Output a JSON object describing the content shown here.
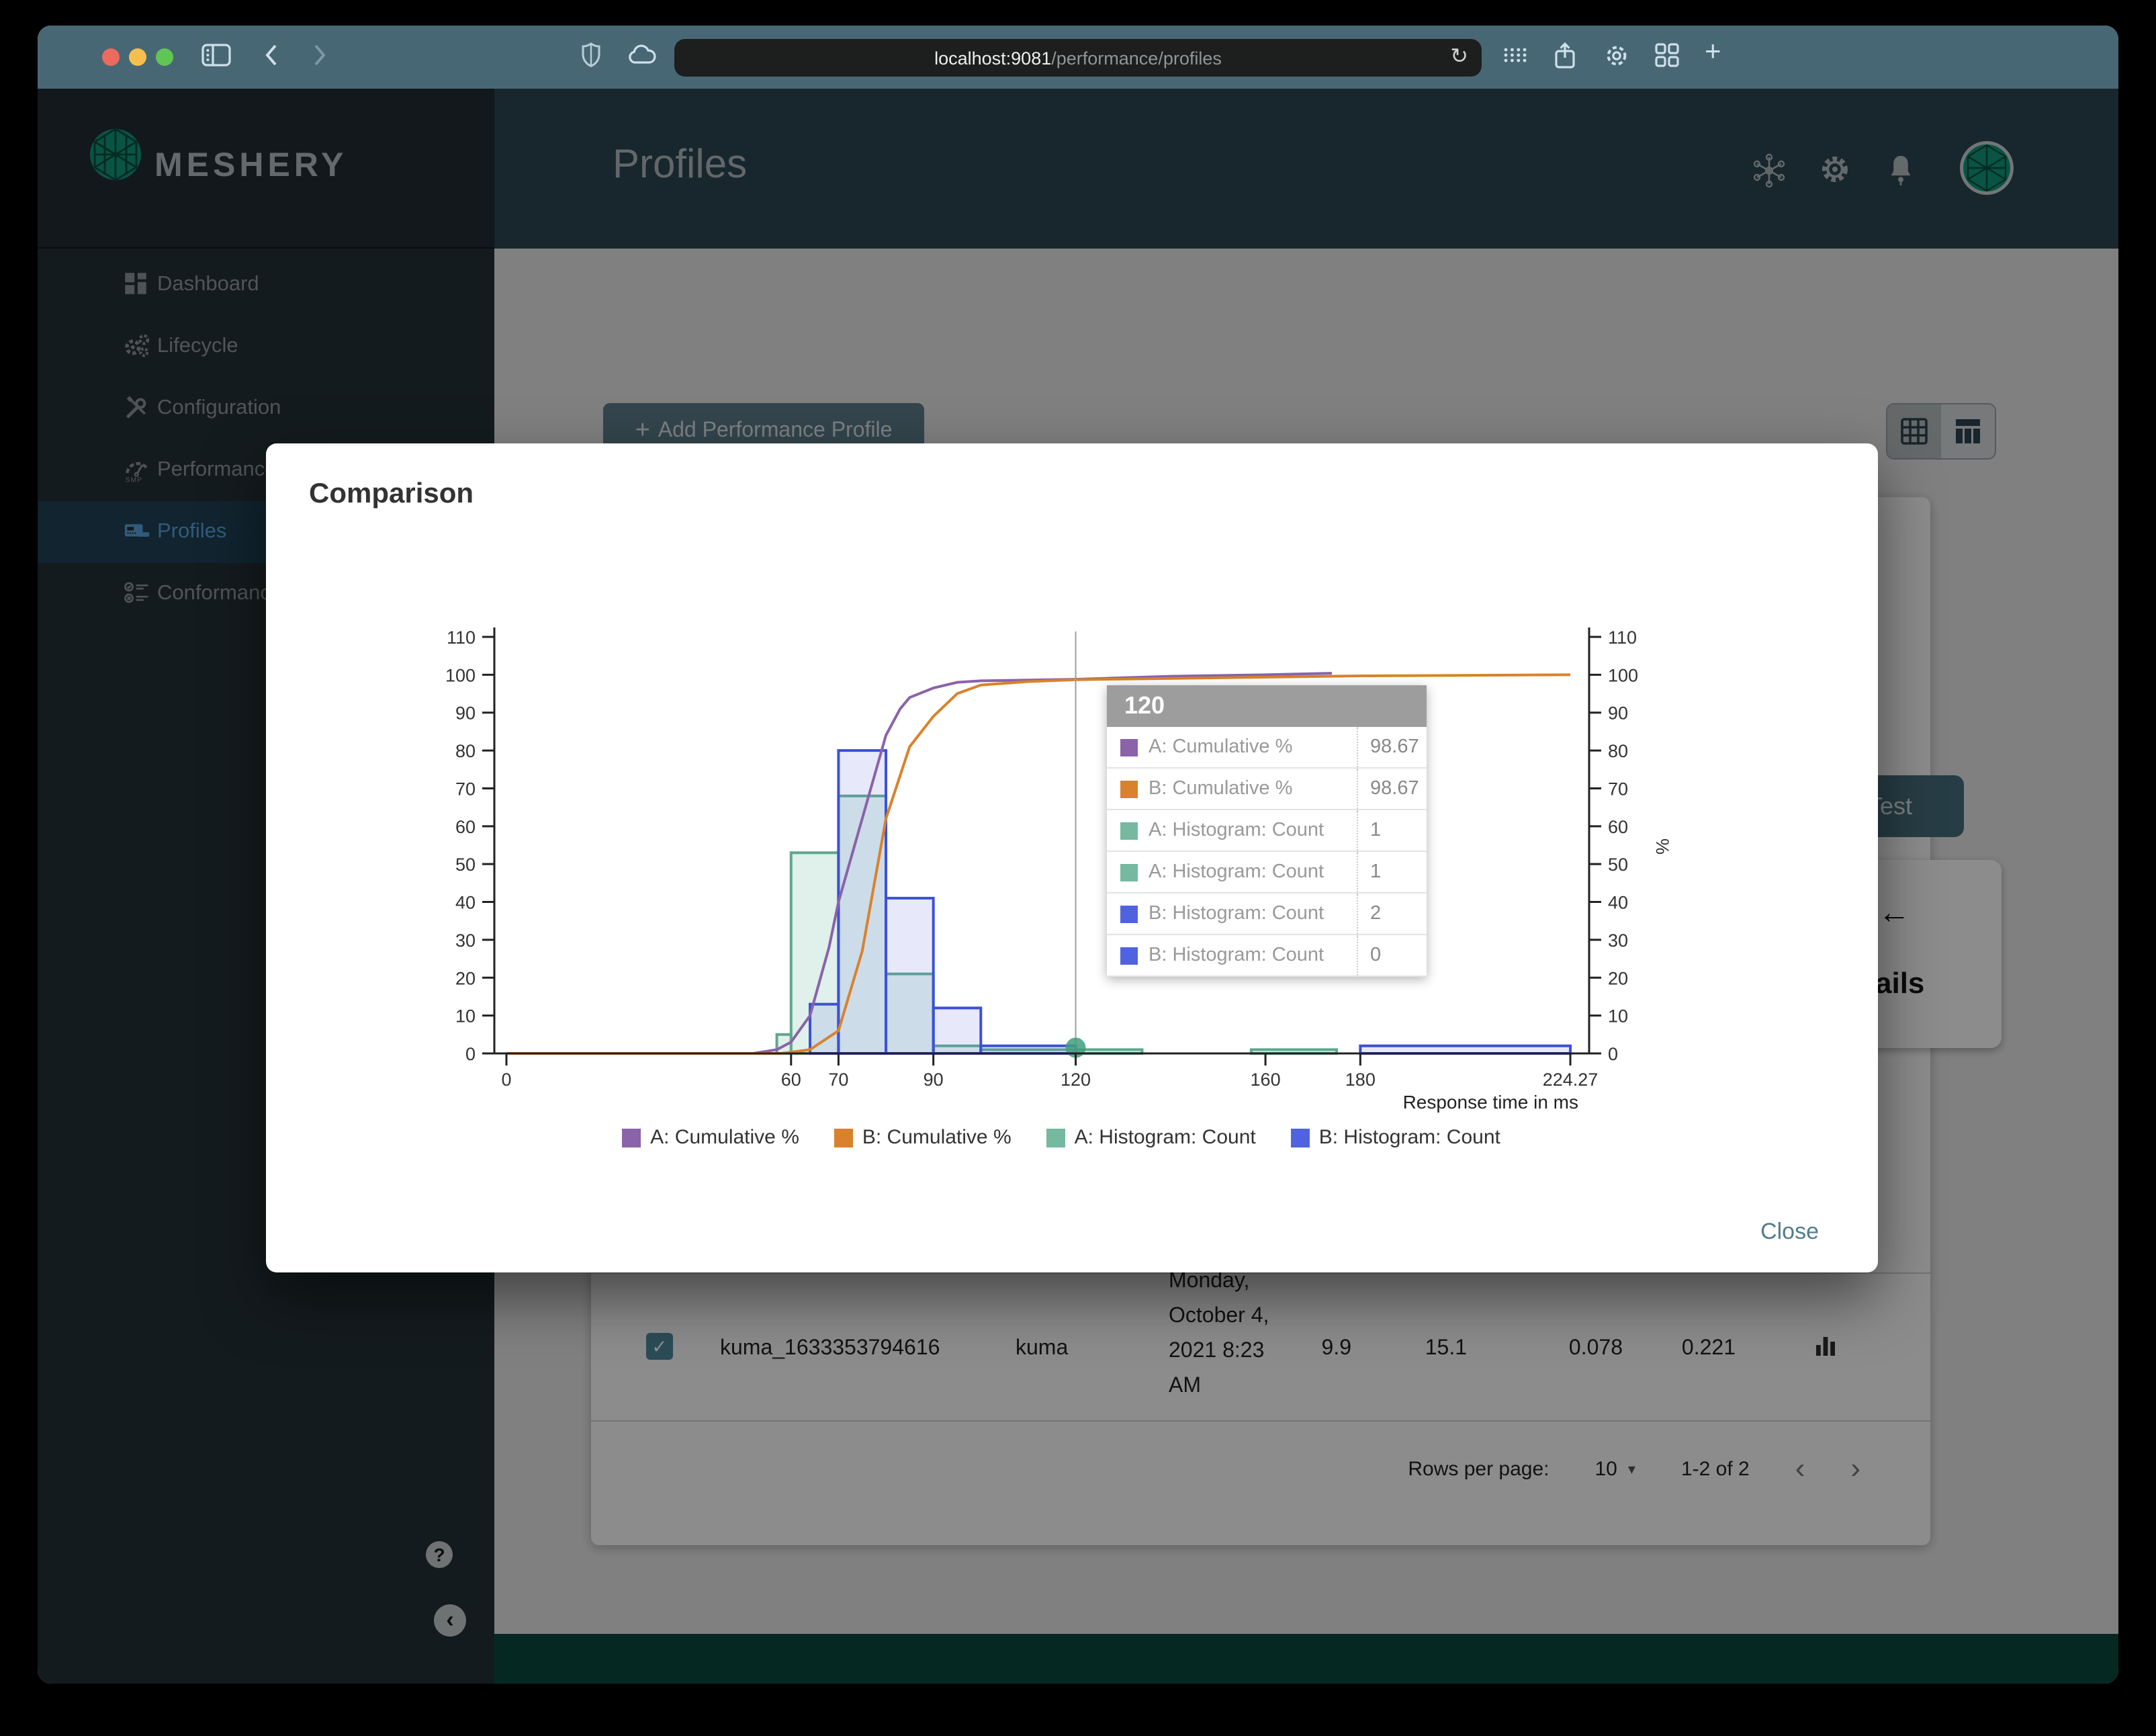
{
  "browser": {
    "url_host": "localhost:9081",
    "url_path": "/performance/profiles",
    "reload_glyph": "↻",
    "plus_glyph": "+"
  },
  "sidebar": {
    "brand": "MESHERY",
    "items": [
      {
        "label": "Dashboard",
        "icon": "dashboard-icon",
        "active": false
      },
      {
        "label": "Lifecycle",
        "icon": "lifecycle-icon",
        "active": false
      },
      {
        "label": "Configuration",
        "icon": "configuration-icon",
        "active": false
      },
      {
        "label": "Performance",
        "icon": "performance-icon",
        "active": false
      },
      {
        "label": "Profiles",
        "icon": "profiles-icon",
        "active": true
      },
      {
        "label": "Conformance",
        "icon": "conformance-icon",
        "active": false
      }
    ],
    "smp_label": "SMP",
    "help_glyph": "?",
    "collapse_glyph": "‹"
  },
  "header": {
    "title": "Profiles"
  },
  "content": {
    "add_profile_button": "Add Performance Profile",
    "test_button": "Test",
    "back_arrow": "←",
    "details_fragment": "ails",
    "row": {
      "checkbox_glyph": "✓",
      "name": "kuma_1633353794616",
      "mesh": "kuma",
      "date": "Monday, October 4, 2021 8:23 AM",
      "qps": "9.9",
      "duration": "15.1",
      "p50": "0.078",
      "p99": "0.221"
    },
    "pagination": {
      "label": "Rows per page:",
      "value": "10",
      "caret": "▾",
      "range": "1-2 of 2",
      "prev": "‹",
      "next": "›"
    }
  },
  "modal": {
    "title": "Comparison",
    "close_button": "Close"
  },
  "chart_data": {
    "type": "histogram+cumulative-line",
    "title": "",
    "xlabel": "Response time in ms",
    "right_axis_label": "%",
    "xlim": [
      0,
      224.27
    ],
    "ylim": [
      0,
      110
    ],
    "x_ticks": [
      0,
      60,
      70,
      90,
      120,
      160,
      180,
      224.27
    ],
    "y_ticks": [
      0,
      10,
      20,
      30,
      40,
      50,
      60,
      70,
      80,
      90,
      100,
      110
    ],
    "grid": false,
    "legend_position": "bottom",
    "hover": {
      "x": 120,
      "dot_y": 1.5,
      "dot_color": "#3f9e7d",
      "line_color": "#9e9e9e"
    },
    "series": [
      {
        "name": "A: Histogram: Count",
        "type": "histogram",
        "fill": "rgba(116,185,160,0.22)",
        "stroke": "#5fa78e",
        "bins": [
          [
            57,
            60,
            5
          ],
          [
            60,
            70,
            53
          ],
          [
            70,
            80,
            68
          ],
          [
            80,
            90,
            21
          ],
          [
            90,
            100,
            2
          ],
          [
            100,
            134,
            1
          ],
          [
            157,
            175,
            1
          ]
        ]
      },
      {
        "name": "B: Histogram: Count",
        "type": "histogram",
        "fill": "rgba(91,110,226,0.15)",
        "stroke": "#3c51d8",
        "bins": [
          [
            64,
            70,
            13
          ],
          [
            70,
            80,
            80
          ],
          [
            80,
            90,
            41
          ],
          [
            90,
            100,
            12
          ],
          [
            100,
            120,
            2
          ],
          [
            180,
            224.27,
            2
          ]
        ]
      },
      {
        "name": "A: Cumulative %",
        "type": "line",
        "color": "#8a63a9",
        "points": [
          [
            0,
            0
          ],
          [
            52,
            0
          ],
          [
            57,
            1
          ],
          [
            60,
            3
          ],
          [
            64,
            10
          ],
          [
            68,
            28
          ],
          [
            70,
            40
          ],
          [
            75,
            62
          ],
          [
            80,
            84
          ],
          [
            83,
            91
          ],
          [
            85,
            94
          ],
          [
            90,
            96.5
          ],
          [
            95,
            98
          ],
          [
            100,
            98.4
          ],
          [
            120,
            98.8
          ],
          [
            140,
            99.6
          ],
          [
            160,
            100
          ],
          [
            174,
            100.4
          ]
        ]
      },
      {
        "name": "B: Cumulative %",
        "type": "line",
        "color": "#d9822b",
        "points": [
          [
            0,
            0
          ],
          [
            58,
            0
          ],
          [
            64,
            1
          ],
          [
            70,
            6
          ],
          [
            75,
            27
          ],
          [
            80,
            62
          ],
          [
            85,
            81
          ],
          [
            90,
            89
          ],
          [
            95,
            95
          ],
          [
            100,
            97.3
          ],
          [
            110,
            98.2
          ],
          [
            120,
            98.7
          ],
          [
            150,
            99.2
          ],
          [
            180,
            99.7
          ],
          [
            224.27,
            100
          ]
        ]
      }
    ],
    "legend": [
      {
        "label": "A: Cumulative %",
        "color": "#8a63a9"
      },
      {
        "label": "B: Cumulative %",
        "color": "#d9822b"
      },
      {
        "label": "A: Histogram: Count",
        "color": "#74b9a0"
      },
      {
        "label": "B: Histogram: Count",
        "color": "#4f63e0"
      }
    ],
    "tooltip": {
      "header": "120",
      "rows": [
        {
          "label": "A: Cumulative %",
          "value": "98.67",
          "color": "#8a63a9"
        },
        {
          "label": "B: Cumulative %",
          "value": "98.67",
          "color": "#d9822b"
        },
        {
          "label": "A: Histogram: Count",
          "value": "1",
          "color": "#74b9a0"
        },
        {
          "label": "A: Histogram: Count",
          "value": "1",
          "color": "#74b9a0"
        },
        {
          "label": "B: Histogram: Count",
          "value": "2",
          "color": "#4f63e0"
        },
        {
          "label": "B: Histogram: Count",
          "value": "0",
          "color": "#4f63e0"
        }
      ]
    }
  }
}
